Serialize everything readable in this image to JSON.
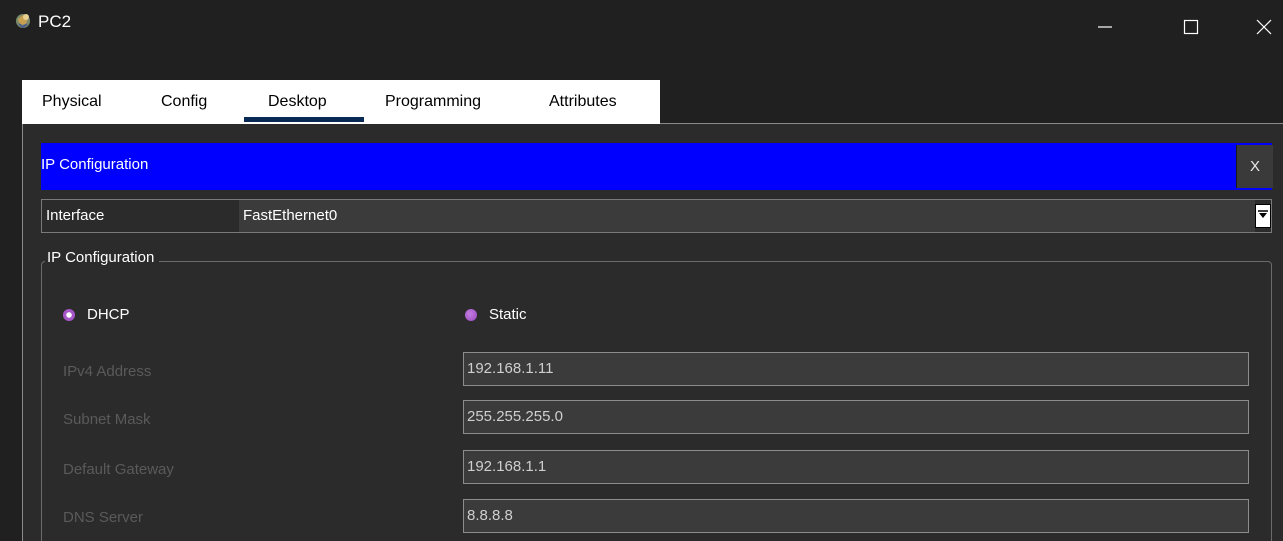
{
  "window": {
    "title": "PC2",
    "icon": "packet-tracer-pc-icon"
  },
  "window_controls": {
    "minimize": "minimize-icon",
    "maximize": "maximize-icon",
    "close": "close-icon"
  },
  "tabs": [
    {
      "label": "Physical",
      "active": false
    },
    {
      "label": "Config",
      "active": false
    },
    {
      "label": "Desktop",
      "active": true
    },
    {
      "label": "Programming",
      "active": false
    },
    {
      "label": "Attributes",
      "active": false
    }
  ],
  "ip_config": {
    "header_title": "IP Configuration",
    "close_label": "X",
    "interface_label": "Interface",
    "interface_value": "FastEthernet0",
    "group_title": "IP Configuration",
    "mode_options": [
      {
        "label": "DHCP",
        "selected": true
      },
      {
        "label": "Static",
        "selected": false
      }
    ],
    "fields": {
      "ipv4": {
        "label": "IPv4 Address",
        "value": "192.168.1.11"
      },
      "subnet": {
        "label": "Subnet Mask",
        "value": "255.255.255.0"
      },
      "gateway": {
        "label": "Default Gateway",
        "value": "192.168.1.1"
      },
      "dns": {
        "label": "DNS Server",
        "value": "8.8.8.8"
      }
    }
  },
  "colors": {
    "header_blue": "#0000ff",
    "background": "#202020",
    "panel": "#2b2b2b",
    "radio_accent": "#a855c8",
    "tab_underline": "#0a2a56"
  }
}
